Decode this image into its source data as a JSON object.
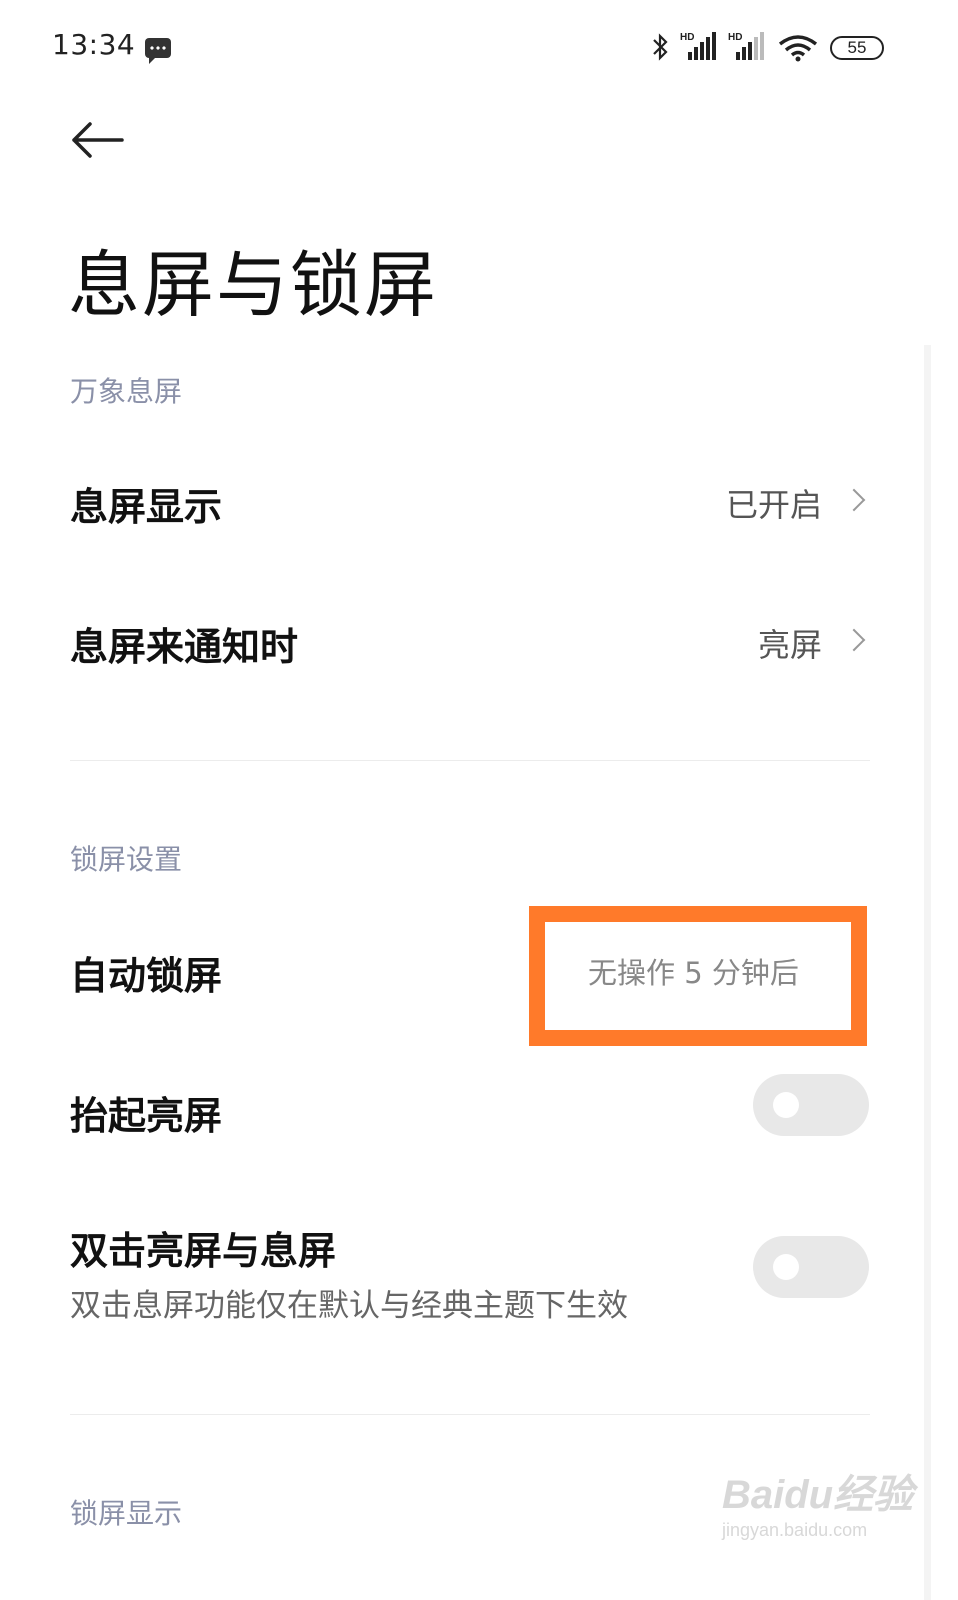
{
  "status_bar": {
    "time": "13:34",
    "battery": "55",
    "signal_badge": "HD"
  },
  "header": {
    "title": "息屏与锁屏"
  },
  "sections": {
    "aod": {
      "title": "万象息屏",
      "display": {
        "label": "息屏显示",
        "value": "已开启"
      },
      "notify": {
        "label": "息屏来通知时",
        "value": "亮屏"
      }
    },
    "lock": {
      "title": "锁屏设置",
      "auto_lock": {
        "label": "自动锁屏",
        "value": "无操作 5 分钟后"
      },
      "raise_wake": {
        "label": "抬起亮屏",
        "enabled": false
      },
      "double_tap": {
        "label": "双击亮屏与息屏",
        "subtitle": "双击息屏功能仅在默认与经典主题下生效",
        "enabled": false
      }
    },
    "lock_display": {
      "title": "锁屏显示"
    }
  },
  "watermark": {
    "brand": "Baidu经验",
    "url": "jingyan.baidu.com"
  },
  "colors": {
    "highlight": "#ff7a2a",
    "section_header": "#8a90a8",
    "toggle_off": "#e8e8e8"
  }
}
